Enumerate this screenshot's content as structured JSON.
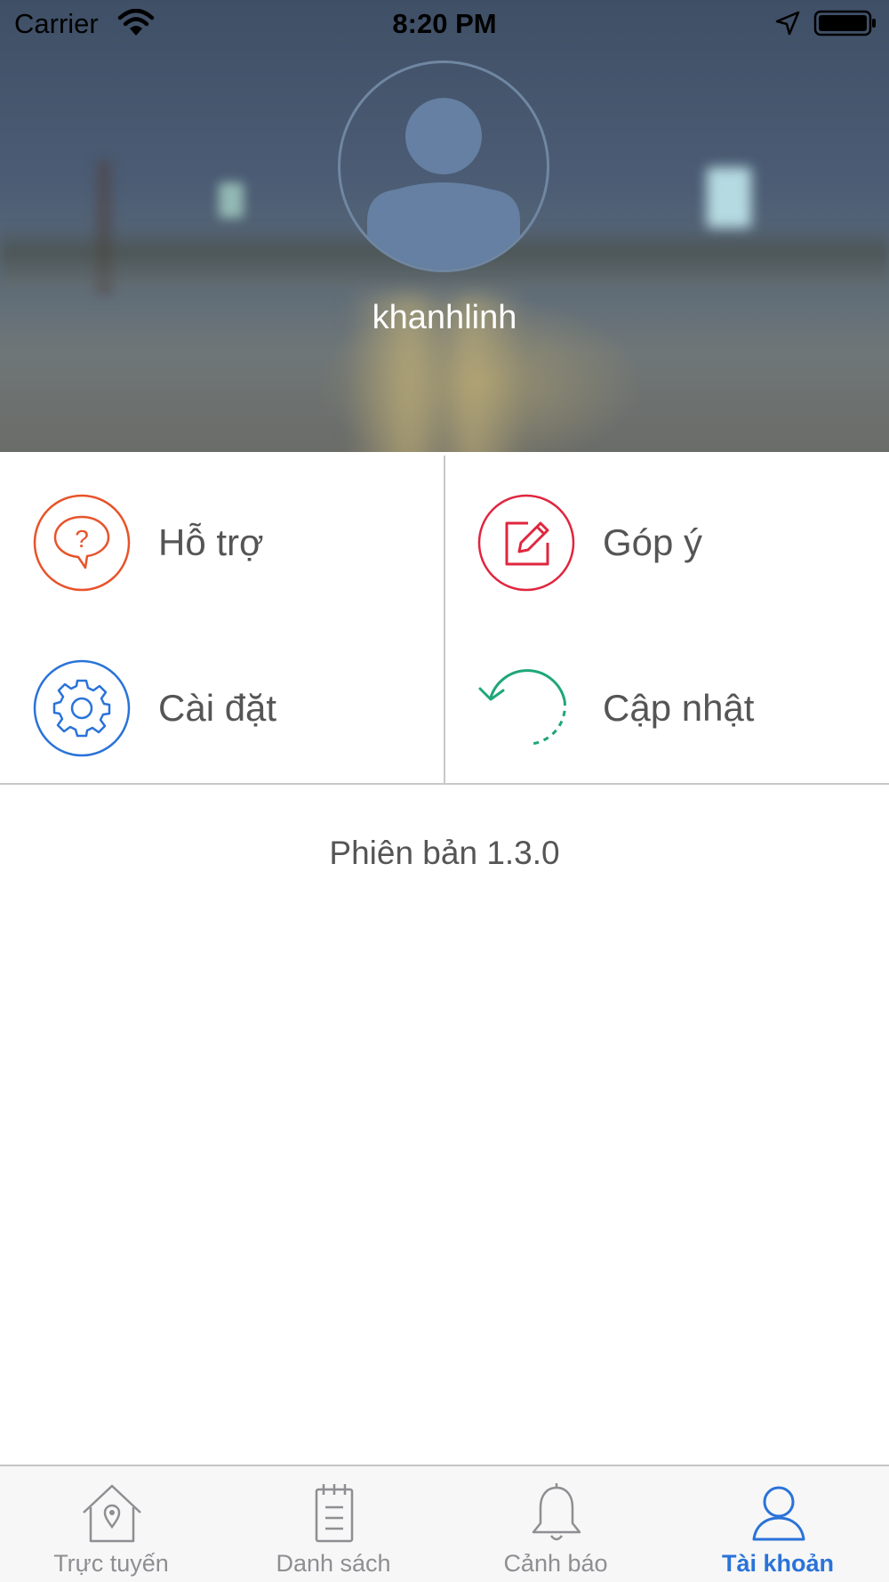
{
  "status_bar": {
    "carrier": "Carrier",
    "time": "8:20 PM"
  },
  "profile": {
    "username": "khanhlinh"
  },
  "menu": {
    "items": [
      {
        "label": "Hỗ trợ",
        "icon": "help-chat-icon",
        "color": "#e8532a"
      },
      {
        "label": "Góp ý",
        "icon": "edit-icon",
        "color": "#e0263f"
      },
      {
        "label": "Cài đặt",
        "icon": "gear-icon",
        "color": "#2a73d9"
      },
      {
        "label": "Cập nhật",
        "icon": "refresh-icon",
        "color": "#1ea67a"
      }
    ]
  },
  "version_text": "Phiên bản 1.3.0",
  "tab_bar": {
    "active_color": "#2a73d9",
    "tabs": [
      {
        "label": "Trực tuyến",
        "icon": "home-location-icon",
        "active": false
      },
      {
        "label": "Danh sách",
        "icon": "notepad-list-icon",
        "active": false
      },
      {
        "label": "Cảnh báo",
        "icon": "bell-icon",
        "active": false
      },
      {
        "label": "Tài khoản",
        "icon": "user-icon",
        "active": true
      }
    ]
  }
}
